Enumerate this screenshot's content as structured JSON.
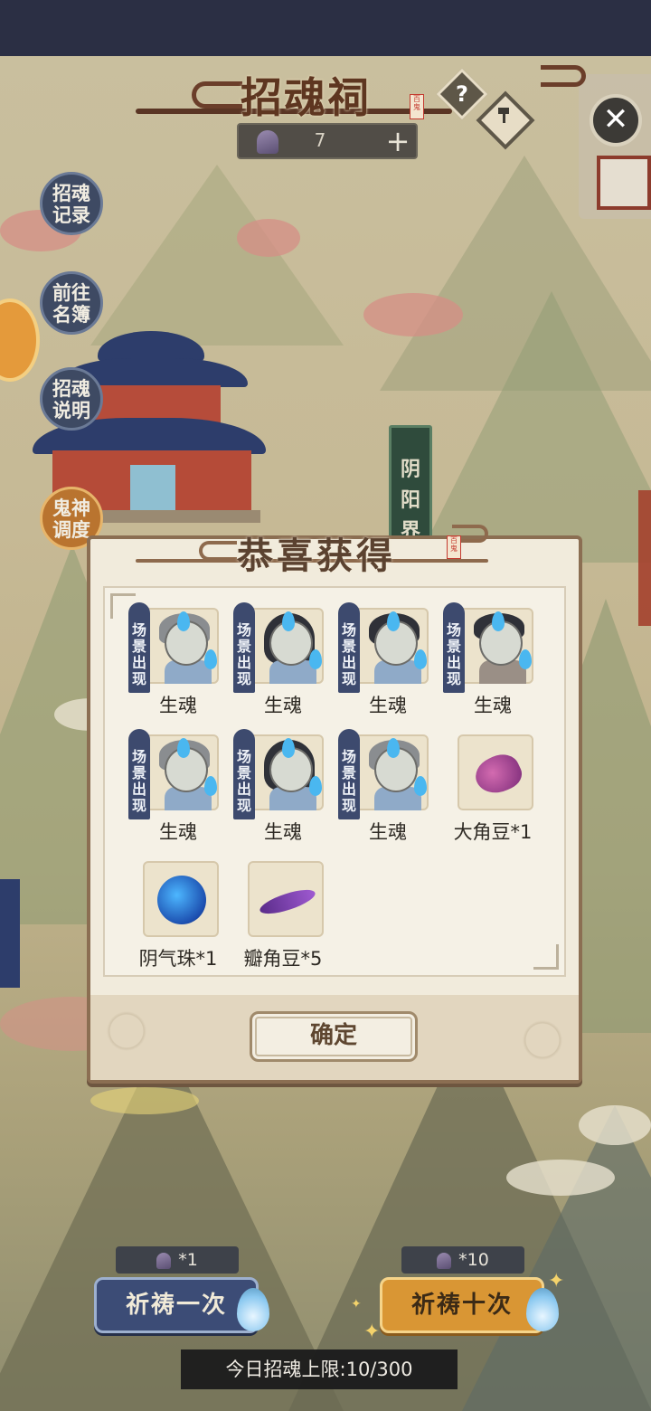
{
  "header": {
    "title": "招魂祠",
    "seal": "百鬼",
    "currency_value": "7",
    "plus_label": "+",
    "help_label": "?",
    "close_label": "✕"
  },
  "side_menu": {
    "record": "招魂\n记录",
    "roster": "前往\n名簿",
    "explain": "招魂\n说明",
    "dispatch": "鬼神\n调度"
  },
  "banner_text": "阴阳界",
  "modal": {
    "title": "恭喜获得",
    "seal": "百鬼",
    "confirm_label": "确定",
    "rewards": [
      {
        "name": "生魂",
        "tag": "场景出现",
        "kind": "elder"
      },
      {
        "name": "生魂",
        "tag": "场景出现",
        "kind": "girl"
      },
      {
        "name": "生魂",
        "tag": "场景出现",
        "kind": "boy"
      },
      {
        "name": "生魂",
        "tag": "场景出现",
        "kind": "man"
      },
      {
        "name": "生魂",
        "tag": "场景出现",
        "kind": "elder"
      },
      {
        "name": "生魂",
        "tag": "场景出现",
        "kind": "girl"
      },
      {
        "name": "生魂",
        "tag": "场景出现",
        "kind": "elder"
      },
      {
        "name": "大角豆*1",
        "tag": "",
        "kind": "bean-big"
      },
      {
        "name": "阴气珠*1",
        "tag": "",
        "kind": "orb"
      },
      {
        "name": "瓣角豆*5",
        "tag": "",
        "kind": "bean-thin"
      }
    ]
  },
  "bottom": {
    "pray_once": {
      "label": "祈祷一次",
      "cost": "*1"
    },
    "pray_ten": {
      "label": "祈祷十次",
      "cost": "*10"
    },
    "daily_limit": "今日招魂上限:10/300"
  },
  "icons": {
    "currency": "bell-icon",
    "help": "question-icon",
    "forge": "hammer-icon",
    "close": "close-icon"
  }
}
